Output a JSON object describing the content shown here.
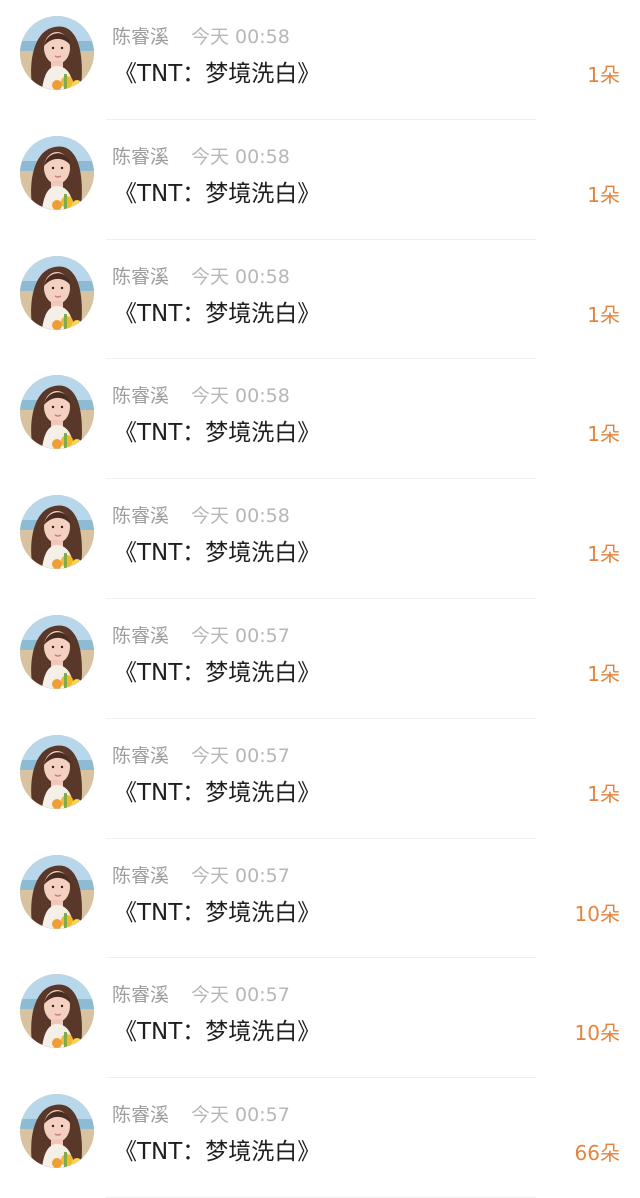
{
  "records": [
    {
      "name": "陈睿溪",
      "time": "今天 00:58",
      "message": "《TNT：梦境洗白》",
      "count": "1朵"
    },
    {
      "name": "陈睿溪",
      "time": "今天 00:58",
      "message": "《TNT：梦境洗白》",
      "count": "1朵"
    },
    {
      "name": "陈睿溪",
      "time": "今天 00:58",
      "message": "《TNT：梦境洗白》",
      "count": "1朵"
    },
    {
      "name": "陈睿溪",
      "time": "今天 00:58",
      "message": "《TNT：梦境洗白》",
      "count": "1朵"
    },
    {
      "name": "陈睿溪",
      "time": "今天 00:58",
      "message": "《TNT：梦境洗白》",
      "count": "1朵"
    },
    {
      "name": "陈睿溪",
      "time": "今天 00:57",
      "message": "《TNT：梦境洗白》",
      "count": "1朵"
    },
    {
      "name": "陈睿溪",
      "time": "今天 00:57",
      "message": "《TNT：梦境洗白》",
      "count": "1朵"
    },
    {
      "name": "陈睿溪",
      "time": "今天 00:57",
      "message": "《TNT：梦境洗白》",
      "count": "10朵"
    },
    {
      "name": "陈睿溪",
      "time": "今天 00:57",
      "message": "《TNT：梦境洗白》",
      "count": "10朵"
    },
    {
      "name": "陈睿溪",
      "time": "今天 00:57",
      "message": "《TNT：梦境洗白》",
      "count": "66朵"
    }
  ],
  "colors": {
    "count_accent": "#e4843f",
    "name_gray": "#9c9c9c",
    "time_gray": "#b7b7b7"
  },
  "icons": {
    "avatar": "user-avatar"
  }
}
